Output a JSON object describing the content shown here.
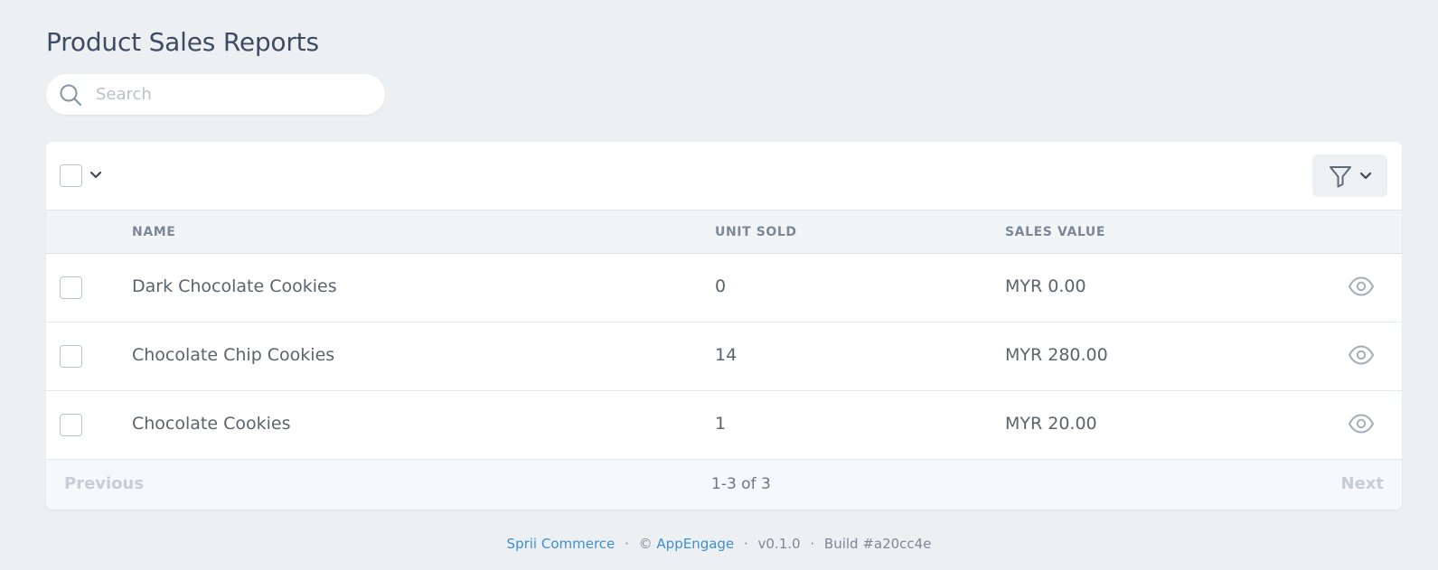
{
  "page": {
    "title": "Product Sales Reports"
  },
  "search": {
    "placeholder": "Search",
    "value": "",
    "icon": "search-icon"
  },
  "toolbar": {
    "select_caret_icon": "chevron-down-icon",
    "filter_icon": "filter-icon"
  },
  "table": {
    "columns": [
      "NAME",
      "UNIT SOLD",
      "SALES VALUE"
    ],
    "rows": [
      {
        "name": "Dark Chocolate Cookies",
        "unit_sold": "0",
        "sales_value": "MYR 0.00"
      },
      {
        "name": "Chocolate Chip Cookies",
        "unit_sold": "14",
        "sales_value": "MYR 280.00"
      },
      {
        "name": "Chocolate Cookies",
        "unit_sold": "1",
        "sales_value": "MYR 20.00"
      }
    ],
    "row_action_icon": "eye-icon"
  },
  "pagination": {
    "previous": "Previous",
    "range": "1-3 of 3",
    "next": "Next"
  },
  "footer": {
    "brand": "Sprii Commerce",
    "copyright": "©",
    "company": "AppEngage",
    "version": "v0.1.0",
    "build": "Build #a20cc4e",
    "separator": "·"
  },
  "colors": {
    "link": "#3f8fd0",
    "background": "#edf0f3"
  }
}
